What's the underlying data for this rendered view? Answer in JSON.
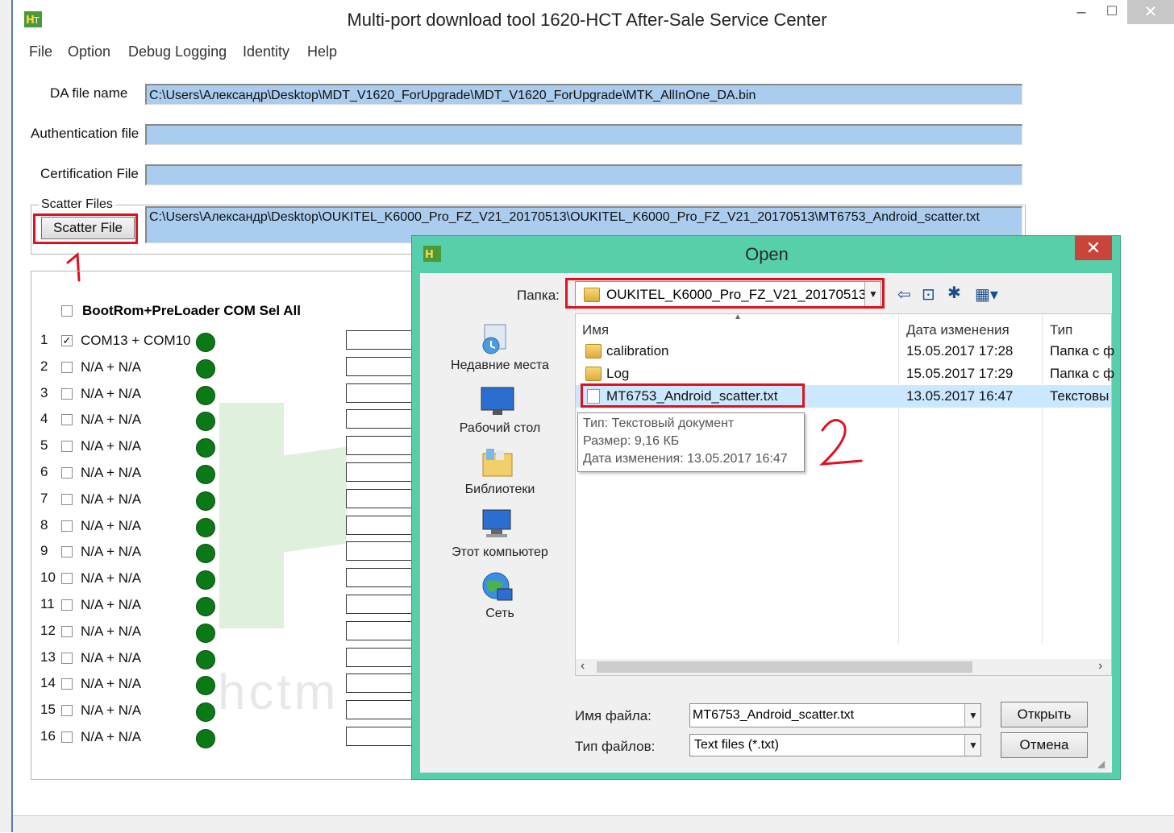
{
  "window": {
    "title": "Multi-port download tool 1620-HCT After-Sale Service Center",
    "minimize": "–",
    "maximize": "☐",
    "close": "✕"
  },
  "menu": [
    "File",
    "Option",
    "Debug Logging",
    "Identity",
    "Help"
  ],
  "fields": {
    "da_label": "DA file name",
    "da_value": "C:\\Users\\Александр\\Desktop\\MDT_V1620_ForUpgrade\\MDT_V1620_ForUpgrade\\MTK_AllInOne_DA.bin",
    "auth_label": "Authentication file",
    "auth_value": "",
    "cert_label": "Certification File",
    "cert_value": "",
    "scatter_group": "Scatter Files",
    "scatter_button": "Scatter File",
    "scatter_value": "C:\\Users\\Александр\\Desktop\\OUKITEL_K6000_Pro_FZ_V21_20170513\\OUKITEL_K6000_Pro_FZ_V21_20170513\\MT6753_Android_scatter.txt"
  },
  "ports": {
    "select_all": "BootRom+PreLoader COM Sel All",
    "rows": [
      {
        "num": "1",
        "label": "COM13 + COM10",
        "checked": true
      },
      {
        "num": "2",
        "label": "N/A + N/A",
        "checked": false
      },
      {
        "num": "3",
        "label": "N/A + N/A",
        "checked": false
      },
      {
        "num": "4",
        "label": "N/A + N/A",
        "checked": false
      },
      {
        "num": "5",
        "label": "N/A + N/A",
        "checked": false
      },
      {
        "num": "6",
        "label": "N/A + N/A",
        "checked": false
      },
      {
        "num": "7",
        "label": "N/A + N/A",
        "checked": false
      },
      {
        "num": "8",
        "label": "N/A + N/A",
        "checked": false
      },
      {
        "num": "9",
        "label": "N/A + N/A",
        "checked": false
      },
      {
        "num": "10",
        "label": "N/A + N/A",
        "checked": false
      },
      {
        "num": "11",
        "label": "N/A + N/A",
        "checked": false
      },
      {
        "num": "12",
        "label": "N/A + N/A",
        "checked": false
      },
      {
        "num": "13",
        "label": "N/A + N/A",
        "checked": false
      },
      {
        "num": "14",
        "label": "N/A + N/A",
        "checked": false
      },
      {
        "num": "15",
        "label": "N/A + N/A",
        "checked": false
      },
      {
        "num": "16",
        "label": "N/A + N/A",
        "checked": false
      }
    ],
    "led_color": "#0b7a16",
    "watermark": "hctm"
  },
  "dialog": {
    "title": "Open",
    "close": "✕",
    "folder_label": "Папка:",
    "folder_value": "OUKITEL_K6000_Pro_FZ_V21_20170513",
    "places": [
      "Недавние места",
      "Рабочий стол",
      "Библиотеки",
      "Этот компьютер",
      "Сеть"
    ],
    "columns": {
      "name": "Имя",
      "date": "Дата изменения",
      "type": "Тип"
    },
    "files": [
      {
        "name": "calibration",
        "date": "15.05.2017 17:28",
        "type": "Папка с ф"
      },
      {
        "name": "Log",
        "date": "15.05.2017 17:29",
        "type": "Папка с ф"
      },
      {
        "name": "MT6753_Android_scatter.txt",
        "date": "13.05.2017 16:47",
        "type": "Текстовы"
      }
    ],
    "tooltip": {
      "type": "Тип: Текстовый документ",
      "size": "Размер: 9,16 КБ",
      "date": "Дата изменения: 13.05.2017 16:47"
    },
    "filename_label": "Имя файла:",
    "filename_value": "MT6753_Android_scatter.txt",
    "filetype_label": "Тип файлов:",
    "filetype_value": "Text files (*.txt)",
    "open_button": "Открыть",
    "cancel_button": "Отмена"
  },
  "colors": {
    "field_blue": "#aaccee",
    "dialog_frame": "#57cfab",
    "annotation_red": "#e01020",
    "selection": "#cce8ff"
  }
}
